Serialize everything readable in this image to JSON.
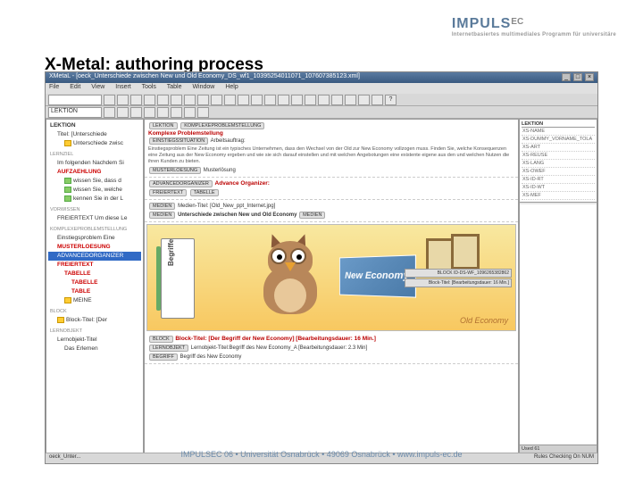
{
  "logo": {
    "main": "IMPULS",
    "ec": "EC",
    "sub": "Internetbasiertes multimediales Programm für universitäre"
  },
  "title": "X-Metal: authoring process",
  "titlebar": {
    "text": "XMetaL - [oeck_Unterschiede zwischen New und Old Economy_DS_wf1_10395254011071_107607385123.xml]"
  },
  "menu": [
    "File",
    "Edit",
    "View",
    "Insert",
    "Tools",
    "Table",
    "Window",
    "Help"
  ],
  "toolbar2_label": "LEKTION",
  "tree": {
    "hdr": "LEKTION",
    "items": [
      {
        "l": "Titel: [Unterschiede",
        "cls": "ind1",
        "ic": ""
      },
      {
        "l": "Unterschiede zwisc",
        "cls": "ind2",
        "ic": "yel"
      },
      {
        "l": "LERNZIEL",
        "cls": "grp",
        "ic": ""
      },
      {
        "l": "Im folgenden Nachdem Si",
        "cls": "ind1",
        "ic": ""
      },
      {
        "l": "AUFZAEHLUNG",
        "cls": "ind1 red",
        "ic": ""
      },
      {
        "l": "wissen Sie, dass d",
        "cls": "ind2",
        "ic": "grn"
      },
      {
        "l": "wissen Sie, welche",
        "cls": "ind2",
        "ic": "grn"
      },
      {
        "l": "kennen Sie in der L",
        "cls": "ind2",
        "ic": "grn"
      },
      {
        "l": "VORWISSEN",
        "cls": "grp",
        "ic": ""
      },
      {
        "l": "FREIERTEXT Um diese Le",
        "cls": "ind1",
        "ic": ""
      },
      {
        "l": "KOMPLEXEPROBLEMSTELLUNG",
        "cls": "grp",
        "ic": ""
      },
      {
        "l": "Einstiegsproblem Eine",
        "cls": "ind1",
        "ic": ""
      },
      {
        "l": "MUSTERLOESUNG",
        "cls": "ind1 red",
        "ic": ""
      },
      {
        "l": "ADVANCEDORGANIZER",
        "cls": "ind1 sel",
        "ic": ""
      },
      {
        "l": "FREIERTEXT",
        "cls": "ind1 red",
        "ic": ""
      },
      {
        "l": "TABELLE",
        "cls": "ind2 red",
        "ic": ""
      },
      {
        "l": "TABELLE",
        "cls": "ind3 red",
        "ic": ""
      },
      {
        "l": "TABLE",
        "cls": "ind3 red",
        "ic": ""
      },
      {
        "l": "MEINE",
        "cls": "ind2",
        "ic": "yel"
      },
      {
        "l": "BLOCK",
        "cls": "grp",
        "ic": ""
      },
      {
        "l": "Block-Titel: [Der",
        "cls": "ind1",
        "ic": "yel"
      },
      {
        "l": "LERNOBJEKT",
        "cls": "grp",
        "ic": ""
      },
      {
        "l": "Lernobjekt-Titel",
        "cls": "ind1",
        "ic": ""
      },
      {
        "l": "Das Erlemen",
        "cls": "ind2",
        "ic": ""
      }
    ]
  },
  "main": {
    "row1_tags": [
      "LEKTION",
      "KOMPLEXEPROBLEMSTELLUNG"
    ],
    "sec1": {
      "title": "Komplexe Problemstellung",
      "tag": "EINSTIEGSSITUATION",
      "sub": "Arbeitsauftrag:",
      "body": "Einstiegsproblem Eine Zeitung ist ein typisches Unternehmen, dass den Wechsel von der Old zur New Economy vollzogen muss. Finden Sie, welche Konsequenzen eine Zeitung aus der New Economy ergeben und wie sie sich darauf einstellen und mit welchen Angebotungen eine existente eigene aus den und welchen Nutzen die ihren Kunden zu bieten.",
      "tag2": "MUSTERLOESUNG",
      "tag2b": "Musterlösung"
    },
    "sec2": {
      "tag": "ADVANCEDORGANIZER",
      "title": "Advance Organizer:",
      "tags2": [
        "FREIERTEXT",
        "TABELLE"
      ]
    },
    "sec3": {
      "tag": "MEDIEN",
      "sub": "Medien-Titel: [Old_New_ppt_Internet.jpg]",
      "title": "Unterschiede zwischen New und Old Economy"
    },
    "binder_label": "Begriffe",
    "newecon": "New Economy",
    "oldecon": "Old Economy",
    "btn1": "BLOCK  ID-DS-WF_1096265382862",
    "btn2": "Block-Titel: [Bearbeitungsdauer: 16 Min.]",
    "sec4": {
      "tag": "BLOCK",
      "title": "Block-Titel: [Der Begriff der New Economy] [Bearbeitungsdauer: 16 Min.]",
      "line2": "Lernobjekt-Titel:Begriff des New Economy_A [Bearbeitungsdauer: 2.3 Min]",
      "tag2": "BEGRIFF",
      "line3": "Begriff des New Economy"
    }
  },
  "right": {
    "hdr": "LEKTION",
    "items": [
      "XS-NAME",
      "XS-DUMMY_VORNAME_TOLA",
      "XS-ART",
      "XS-REUSE",
      "XS-LANG",
      "XS-OWEF",
      "XS-ID-RT",
      "XS-ID-WT",
      "XS-MEF"
    ],
    "bot": "Used  61"
  },
  "statusbar": {
    "left": "oeck_Unter...",
    "right": "Rules Checking On     NUM"
  },
  "footer": "IMPULSEC 06 • Universität Osnabrück • 49069 Osnabrück • www.impuls-ec.de"
}
